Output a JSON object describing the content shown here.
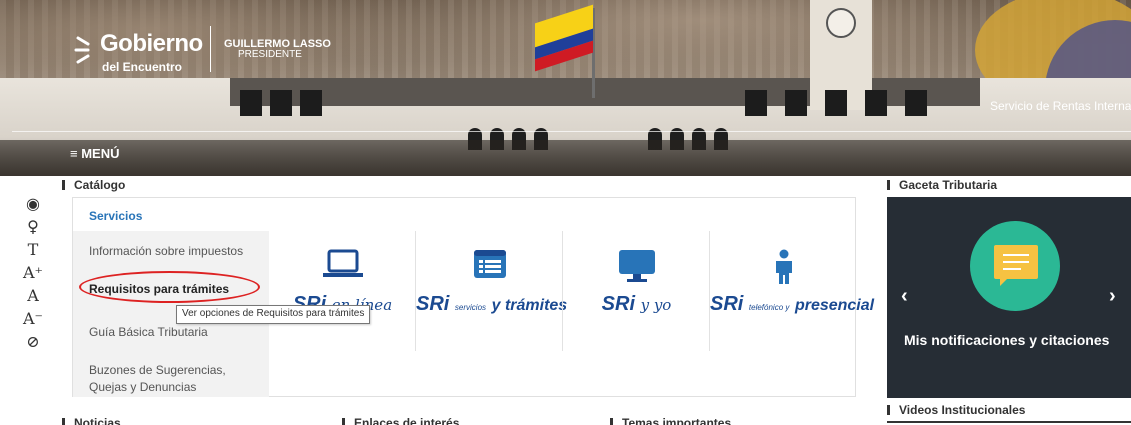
{
  "header": {
    "logo_main": "Gobierno",
    "logo_sub": "del Encuentro",
    "president_name": "GUILLERMO LASSO",
    "president_title": "PRESIDENTE",
    "agency": "Servicio de Rentas Interna",
    "menu_label": "≡ MENÚ"
  },
  "accessibility": {
    "icons": [
      "eye-icon",
      "accessibility-person-icon",
      "text-font-icon",
      "font-increase-icon",
      "font-normal-icon",
      "font-decrease-icon",
      "contrast-off-icon"
    ],
    "glyphs": [
      "◉",
      "♀",
      "T",
      "A⁺",
      "A",
      "A⁻",
      "⊘"
    ]
  },
  "catalog": {
    "title": "Catálogo",
    "tab": "Servicios",
    "menu": [
      "Información sobre impuestos",
      "Requisitos para trámites",
      "Guía Básica Tributaria",
      "Buzones de Sugerencias,",
      "Quejas y Denuncias"
    ],
    "tooltip": "Ver opciones de Requisitos para trámites",
    "services": [
      {
        "brand": "SRi",
        "suffix": "en línea"
      },
      {
        "brand": "SRi",
        "prefix_small": "servicios",
        "suffix": "y trámites"
      },
      {
        "brand": "SRi",
        "suffix": "y yo"
      },
      {
        "brand": "SRi",
        "prefix_small": "telefónico y",
        "suffix": "presencial"
      }
    ]
  },
  "gaceta": {
    "title": "Gaceta Tributaria",
    "caption": "Mis notificaciones y citaciones",
    "prev": "‹",
    "next": "›"
  },
  "bottom": {
    "noticias": "Noticias",
    "enlaces": "Enlaces de interés",
    "temas": "Temas importantes",
    "videos": "Videos Institucionales"
  },
  "colors": {
    "accent_blue": "#2874b8",
    "brand_navy": "#1b4a91",
    "gaceta_bg": "#262d35",
    "gaceta_green": "#2bb895",
    "gaceta_yellow": "#f6c242",
    "highlight_red": "#dd2222"
  }
}
